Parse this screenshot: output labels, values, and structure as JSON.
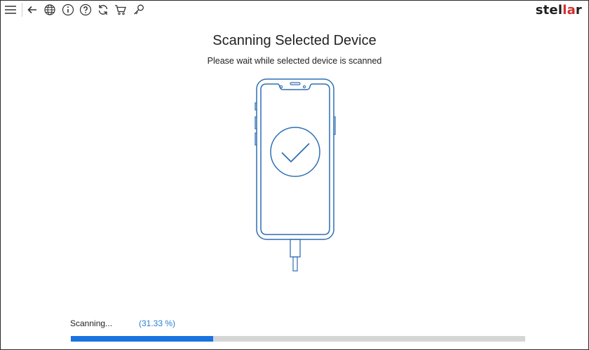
{
  "toolbar": {
    "icons": [
      "menu-icon",
      "back-arrow-icon",
      "globe-icon",
      "info-icon",
      "help-icon",
      "refresh-icon",
      "cart-icon",
      "key-icon"
    ]
  },
  "brand": {
    "logo_prefix": "stel",
    "logo_accent": "la",
    "logo_suffix": "r",
    "accent_color": "#d32c2c"
  },
  "main": {
    "title": "Scanning Selected Device",
    "subtitle": "Please wait while selected device is scanned",
    "illustration": "phone-with-checkmark"
  },
  "progress": {
    "status_label": "Scanning...",
    "percent_label": "(31.33 %)",
    "value": 0.3133,
    "fill_color": "#1a73e0",
    "percent_color": "#2a7ed2"
  }
}
